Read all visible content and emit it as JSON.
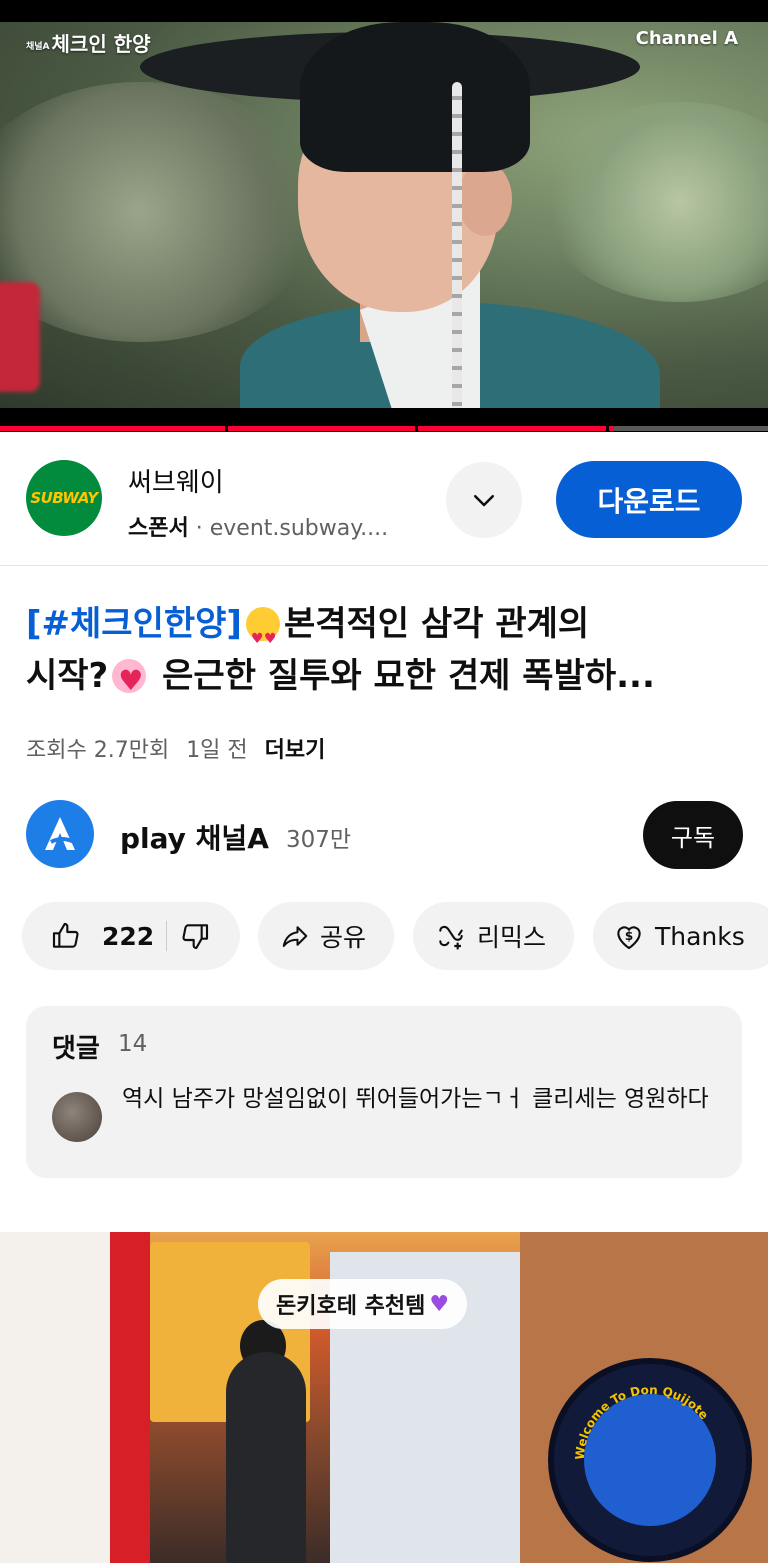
{
  "player": {
    "show_logo": "체크인 한양",
    "show_logo_small": "채널A",
    "broadcaster": "Channel A",
    "progress_fraction": 0.8
  },
  "ad": {
    "advertiser": "써브웨이",
    "logo_text": "SUBWAY",
    "sponsor_label": "스폰서",
    "separator": "·",
    "url": "event.subway....",
    "cta": "다운로드"
  },
  "video": {
    "title_tag": "[#체크인한양]",
    "title_part1": "본격적인 삼각 관계의",
    "title_part2": "시작?",
    "title_part3": "은근한 질투와 묘한 견제 폭발하...",
    "views": "조회수 2.7만회",
    "age": "1일 전",
    "more": "더보기"
  },
  "channel": {
    "name": "play 채널A",
    "subscribers": "307만",
    "subscribe_label": "구독"
  },
  "actions": {
    "likes": "222",
    "share": "공유",
    "remix": "리믹스",
    "thanks": "Thanks"
  },
  "comments": {
    "heading": "댓글",
    "count": "14",
    "top_comment": "역시 남주가 망설임없이 뛰어들어가는ㄱㅓ 클리세는 영원하다"
  },
  "next_video": {
    "bubble_text": "돈키호테 추천템",
    "store_sign_text": "Welcome To Don Quijote"
  },
  "colors": {
    "accent_blue": "#065fd4",
    "progress_red": "#ff0033",
    "chip_bg": "#f2f2f2"
  }
}
